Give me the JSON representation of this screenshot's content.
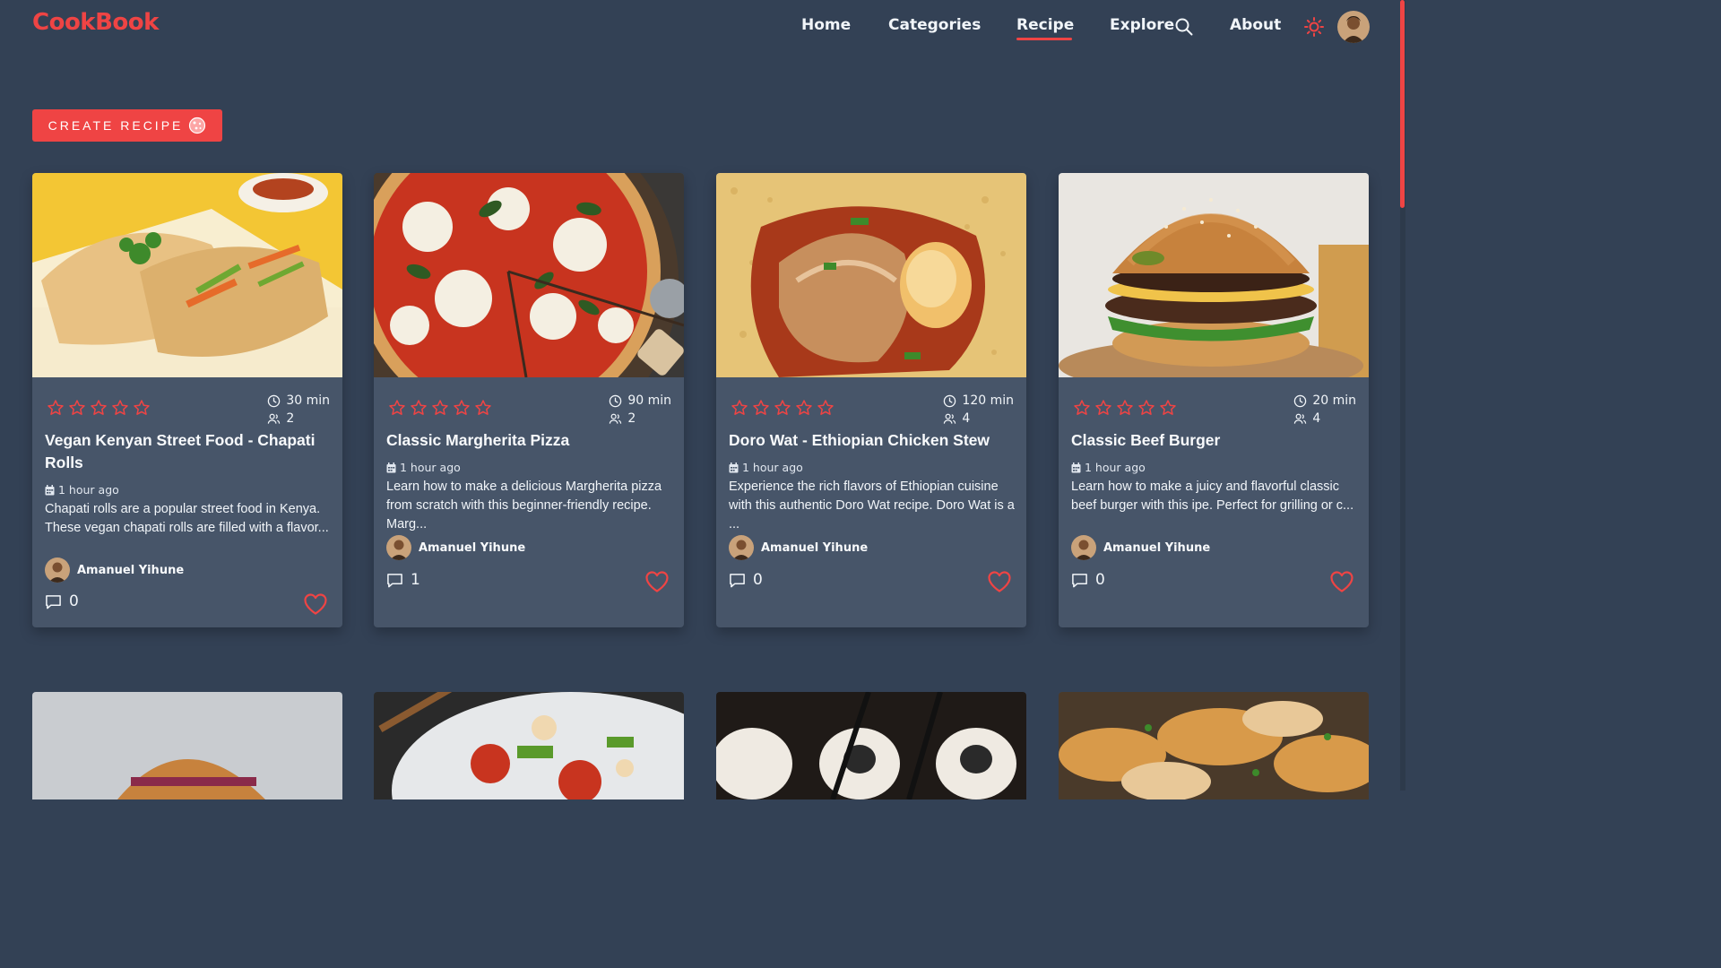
{
  "app": {
    "logo": "CookBook"
  },
  "nav": {
    "items": [
      {
        "label": "Home"
      },
      {
        "label": "Categories"
      },
      {
        "label": "Recipe"
      },
      {
        "label": "Explore"
      },
      {
        "label": "About"
      }
    ],
    "active": "Recipe"
  },
  "create_button": {
    "label": "CREATE RECIPE"
  },
  "recipes": [
    {
      "title": "Vegan Kenyan Street Food - Chapati Rolls",
      "time": "30 min",
      "servings": "2",
      "rating": 0,
      "posted": "1 hour ago",
      "description": "Chapati rolls are a popular street food in Kenya. These vegan chapati rolls are filled with a flavor...",
      "author": "Amanuel Yihune",
      "comments": "0"
    },
    {
      "title": "Classic Margherita Pizza",
      "time": "90 min",
      "servings": "2",
      "rating": 0,
      "posted": "1 hour ago",
      "description": "Learn how to make a delicious Margherita pizza from scratch with this beginner-friendly recipe. Marg...",
      "author": "Amanuel Yihune",
      "comments": "1"
    },
    {
      "title": "Doro Wat - Ethiopian Chicken Stew",
      "time": "120 min",
      "servings": "4",
      "rating": 0,
      "posted": "1 hour ago",
      "description": "Experience the rich flavors of Ethiopian cuisine with this authentic Doro Wat recipe. Doro Wat is a ...",
      "author": "Amanuel Yihune",
      "comments": "0"
    },
    {
      "title": "Classic Beef Burger",
      "time": "20 min",
      "servings": "4",
      "rating": 0,
      "posted": "1 hour ago",
      "description": "Learn how to make a juicy and flavorful classic beef burger with this ipe. Perfect for grilling or c...",
      "author": "Amanuel Yihune",
      "comments": "0"
    }
  ],
  "colors": {
    "background": "#334155",
    "card": "#475569",
    "accent": "#ef4444"
  },
  "icons": {
    "rating": "star-outline-icon",
    "time": "clock-icon",
    "servings": "users-icon",
    "date": "calendar-icon",
    "comments": "comment-icon",
    "favorite": "heart-outline-icon",
    "theme": "sun-icon",
    "search": "search-icon"
  }
}
